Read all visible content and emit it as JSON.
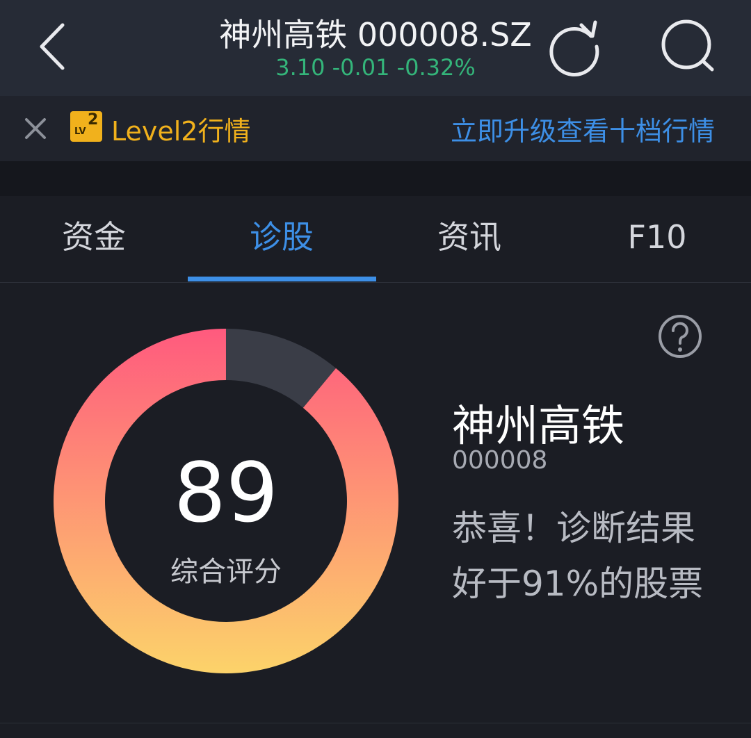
{
  "header": {
    "title": "神州高铁 000008.SZ",
    "quote": "3.10 -0.01 -0.32%",
    "quote_color": "#34b57a",
    "back_icon": "chevron-left-icon",
    "refresh_icon": "refresh-icon",
    "search_icon": "search-icon"
  },
  "level2_bar": {
    "close_icon": "close-icon",
    "badge_lv": "LV",
    "badge_num": "2",
    "label": "Level2行情",
    "upgrade_link": "立即升级查看十档行情",
    "accent_color": "#f1b11c",
    "link_color": "#3d8fe6"
  },
  "tabs": [
    {
      "label": "资金",
      "active": false
    },
    {
      "label": "诊股",
      "active": true
    },
    {
      "label": "资讯",
      "active": false
    },
    {
      "label": "F10",
      "active": false
    }
  ],
  "diagnosis": {
    "help_icon": "question-circle-icon",
    "score": "89",
    "score_label": "综合评分",
    "score_fraction": 0.89,
    "gradient_colors": [
      "#ff5a7e",
      "#fcd36a"
    ],
    "track_color": "#3a3d47",
    "stock_name": "神州高铁",
    "stock_code": "000008",
    "result_line1": "恭喜！诊断结果",
    "result_line2": "好于91%的股票"
  }
}
